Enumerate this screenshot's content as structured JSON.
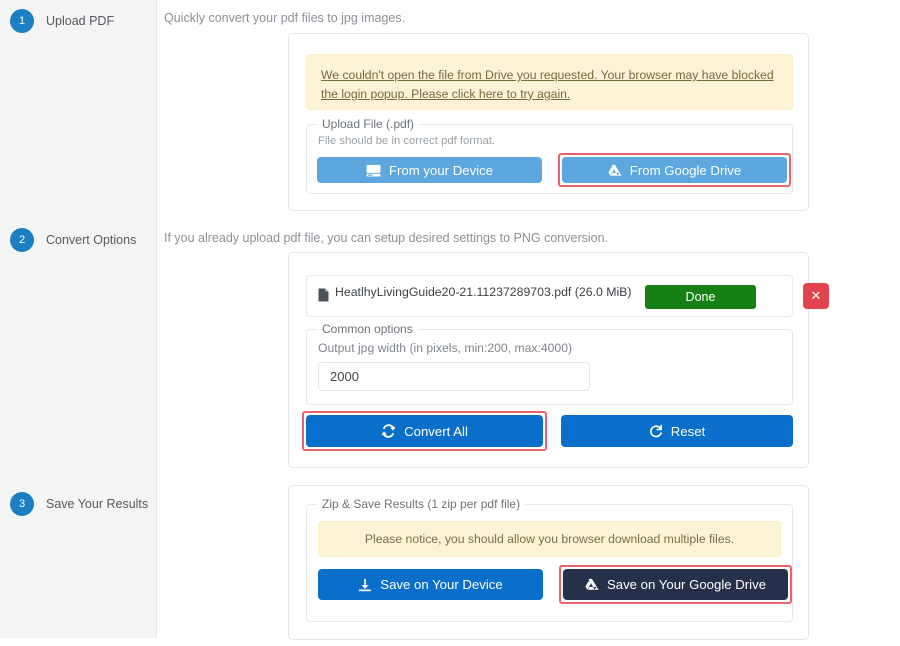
{
  "sidebar": {
    "steps": [
      {
        "number": "1",
        "label": "Upload PDF"
      },
      {
        "number": "2",
        "label": "Convert Options"
      },
      {
        "number": "3",
        "label": "Save Your Results"
      }
    ]
  },
  "section1": {
    "description": "Quickly convert your pdf files to jpg images.",
    "alert": "We couldn't open the file from Drive you requested. Your browser may have blocked the login popup. Please click here to try again.",
    "fieldset_legend": "Upload File (.pdf)",
    "hint": "File should be in correct pdf format.",
    "btn_device": "From your Device",
    "btn_drive": "From Google Drive"
  },
  "section2": {
    "description": "If you already upload pdf file, you can setup desired settings to PNG conversion.",
    "file_name": "HeatlhyLivingGuide20-21.11237289703.pdf",
    "file_size": "(26.0 MiB)",
    "status": "Done",
    "remove_label": "✕",
    "fieldset_legend": "Common options",
    "width_label": "Output jpg width (in pixels, min:200, max:4000)",
    "width_value": "2000",
    "btn_convert": "Convert All",
    "btn_reset": "Reset"
  },
  "section3": {
    "fieldset_legend": "Zip & Save Results (1 zip per pdf file)",
    "notice": "Please notice, you should allow you browser download multiple files.",
    "btn_save_device": "Save on Your Device",
    "btn_save_drive": "Save on Your Google Drive"
  },
  "icons": {
    "hdd": "hdd-icon",
    "google_drive": "google-drive-icon",
    "file": "file-icon",
    "refresh": "refresh-icon",
    "reset": "reset-arrow-icon",
    "download": "download-icon",
    "close": "close-icon"
  },
  "colors": {
    "accent_blue": "#0a6ecb",
    "light_blue": "#5ba7de",
    "navy": "#27304a",
    "green": "#178014",
    "red": "#e1434f",
    "highlight": "#e8646d",
    "alert_bg": "#fcf3d7",
    "sidebar_bg": "#f4f4f4"
  }
}
